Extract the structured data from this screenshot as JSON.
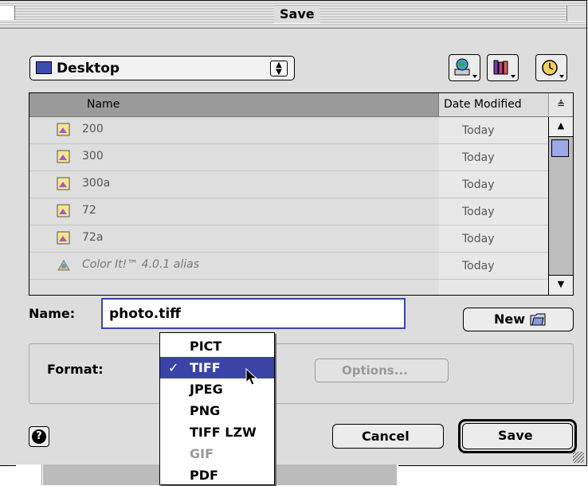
{
  "window": {
    "title": "Save"
  },
  "location": {
    "selected": "Desktop"
  },
  "toolbar": {
    "network_label": "network-volume-icon",
    "shortcuts_label": "shortcuts-icon",
    "recent_label": "recent-clock-icon"
  },
  "file_list": {
    "columns": [
      "Name",
      "Date Modified"
    ],
    "rows": [
      {
        "name": "200",
        "date": "Today"
      },
      {
        "name": "300",
        "date": "Today"
      },
      {
        "name": "300a",
        "date": "Today"
      },
      {
        "name": "72",
        "date": "Today"
      },
      {
        "name": "72a",
        "date": "Today"
      },
      {
        "name": "Color It!™ 4.0.1 alias",
        "date": "Today"
      }
    ]
  },
  "name_field": {
    "label": "Name:",
    "value": "photo.tiff"
  },
  "new_button": {
    "label": "New"
  },
  "format": {
    "label": "Format:",
    "selected": "TIFF",
    "options": [
      "PICT",
      "TIFF",
      "JPEG",
      "PNG",
      "TIFF LZW",
      "GIF",
      "PDF"
    ],
    "disabled": [
      "GIF"
    ],
    "check": "✓"
  },
  "options_button": {
    "label": "Options..."
  },
  "cancel_button": {
    "label": "Cancel"
  },
  "save_button": {
    "label": "Save"
  },
  "help_button": {
    "label": "?"
  },
  "colors": {
    "selection": "#3a44a6",
    "folder": "#3d4dae",
    "thumb": "#9ba9e8"
  }
}
